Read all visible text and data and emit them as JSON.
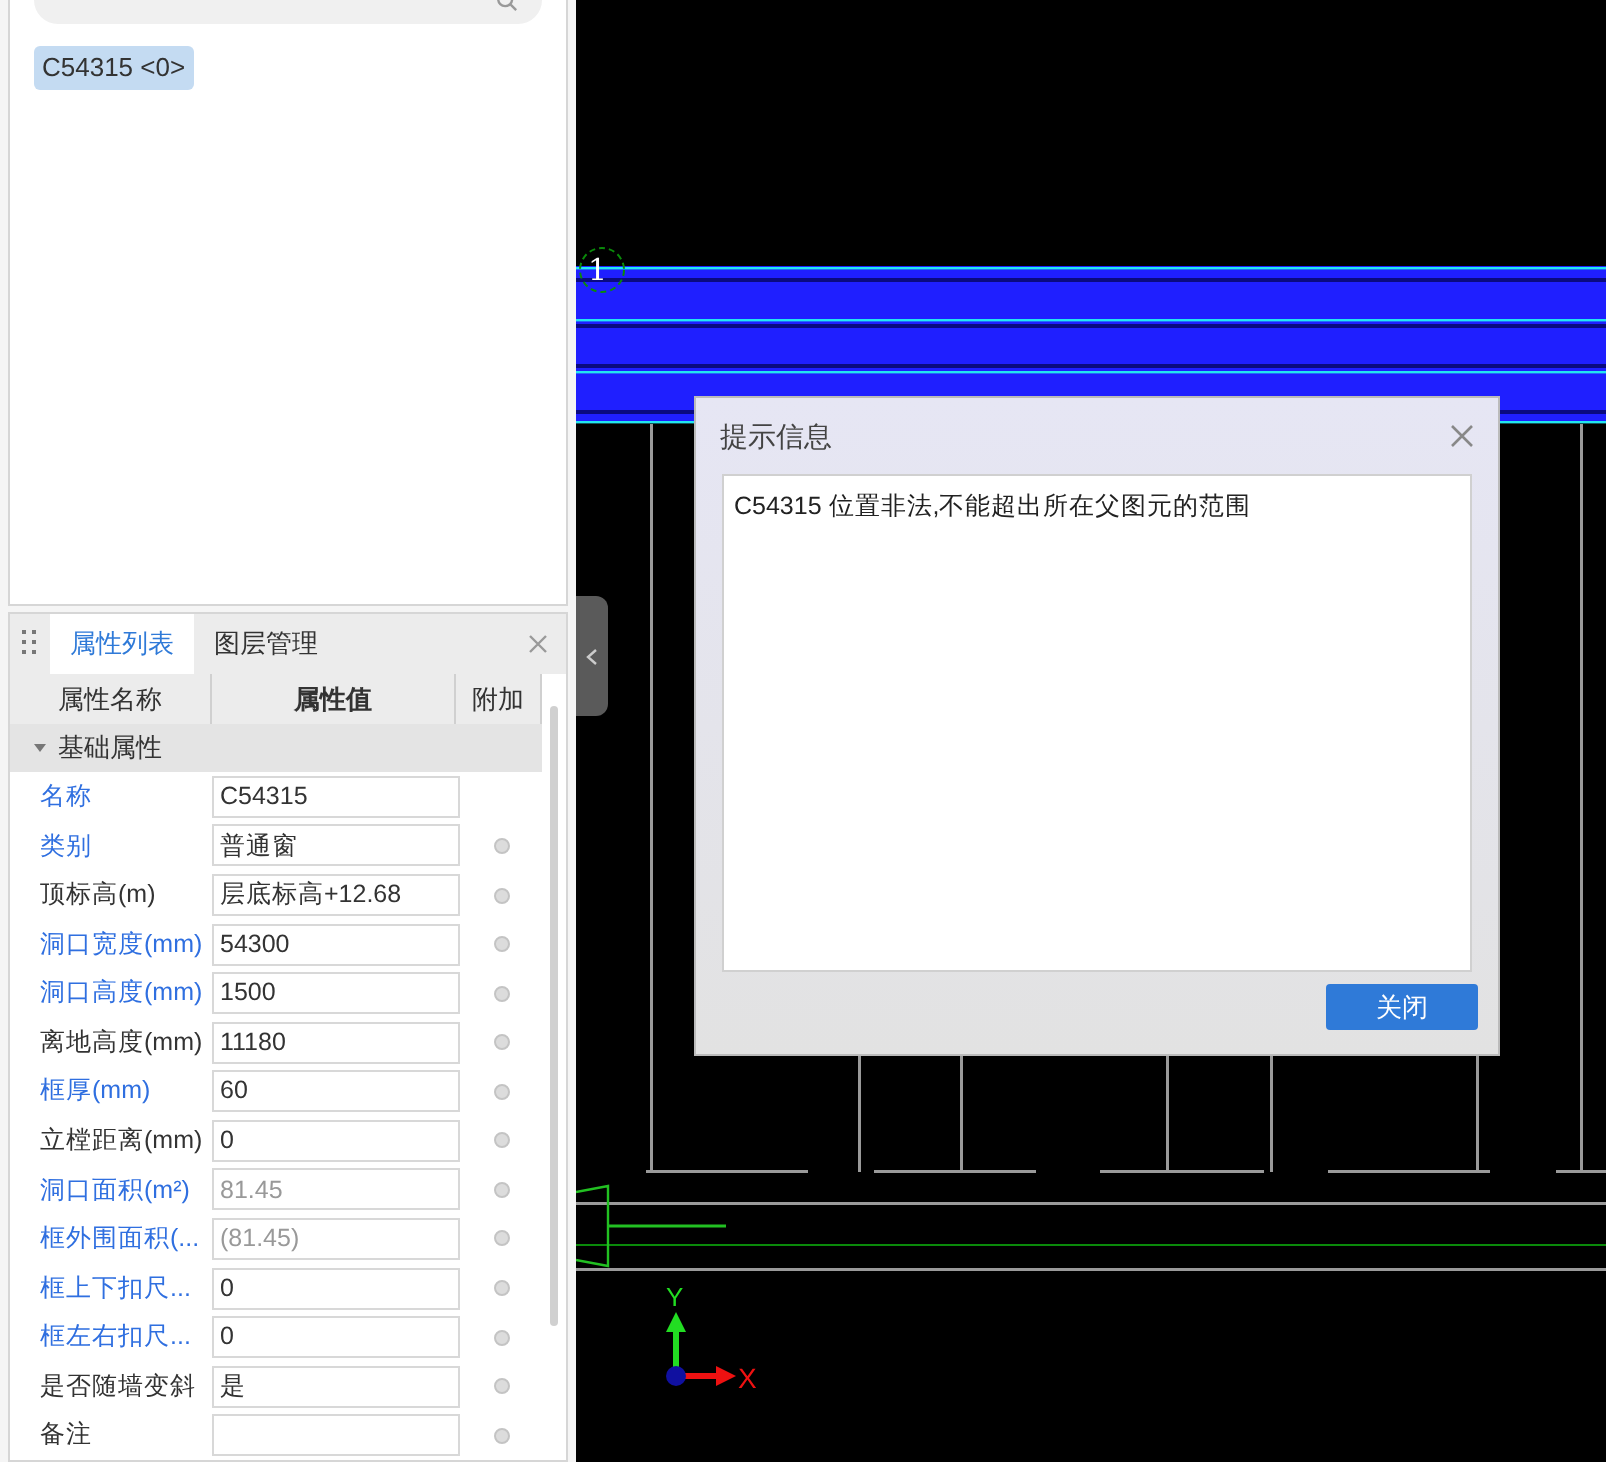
{
  "component_list": [
    {
      "label": "C54315 <0>",
      "selected": true
    }
  ],
  "property_panel": {
    "tabs": [
      {
        "label": "属性列表",
        "selected": true
      },
      {
        "label": "图层管理",
        "selected": false
      }
    ],
    "columns": [
      "属性名称",
      "属性值",
      "附加"
    ],
    "group": {
      "label": "基础属性",
      "expanded": true
    },
    "rows": [
      {
        "name": "名称",
        "value": "C54315",
        "public": true,
        "readonly": false,
        "attach": false
      },
      {
        "name": "类别",
        "value": "普通窗",
        "public": true,
        "readonly": false,
        "attach": true
      },
      {
        "name": "顶标高(m)",
        "value": "层底标高+12.68",
        "public": false,
        "readonly": false,
        "attach": true
      },
      {
        "name": "洞口宽度(mm)",
        "value": "54300",
        "public": true,
        "readonly": false,
        "attach": true
      },
      {
        "name": "洞口高度(mm)",
        "value": "1500",
        "public": true,
        "readonly": false,
        "attach": true
      },
      {
        "name": "离地高度(mm)",
        "value": "11180",
        "public": false,
        "readonly": false,
        "attach": true
      },
      {
        "name": "框厚(mm)",
        "value": "60",
        "public": true,
        "readonly": false,
        "attach": true
      },
      {
        "name": "立樘距离(mm)",
        "value": "0",
        "public": false,
        "readonly": false,
        "attach": true
      },
      {
        "name": "洞口面积(m²)",
        "value": "81.45",
        "public": true,
        "readonly": true,
        "attach": true
      },
      {
        "name": "框外围面积(...",
        "value": "(81.45)",
        "public": true,
        "readonly": true,
        "attach": true
      },
      {
        "name": "框上下扣尺...",
        "value": "0",
        "public": true,
        "readonly": false,
        "attach": true
      },
      {
        "name": "框左右扣尺...",
        "value": "0",
        "public": true,
        "readonly": false,
        "attach": true
      },
      {
        "name": "是否随墙变斜",
        "value": "是",
        "public": false,
        "readonly": false,
        "attach": true
      },
      {
        "name": "备注",
        "public": false,
        "readonly": false,
        "attach": true
      }
    ]
  },
  "canvas": {
    "axis_label": "1",
    "y_axis": "Y",
    "x_axis": "X"
  },
  "dialog": {
    "title": "提示信息",
    "message": "C54315 位置非法,不能超出所在父图元的范围",
    "button": "关闭"
  }
}
